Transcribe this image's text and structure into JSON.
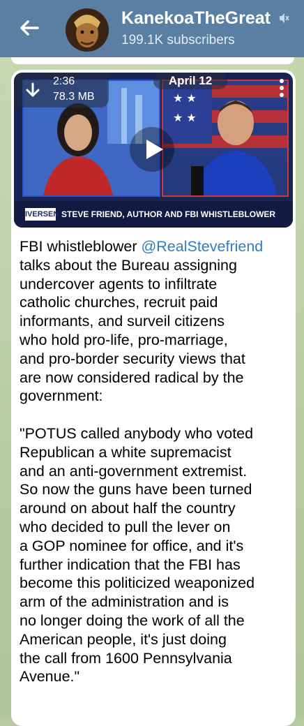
{
  "header": {
    "channel_name": "KanekoaTheGreat",
    "subscribers": "199.1K subscribers",
    "back_icon": "arrow-left-icon",
    "mute_icon": "speaker-muted-icon"
  },
  "video": {
    "duration": "2:36",
    "size": "78.3 MB",
    "date": "April 12",
    "show_name": "IVERSEN",
    "caption": "STEVE FRIEND, AUTHOR AND FBI WHISTLEBLOWER"
  },
  "message": {
    "intro": "FBI whistleblower ",
    "mention": "@RealStevefriend",
    "body": "\ntalks about the Bureau assigning\nundercover agents to infiltrate\ncatholic churches, recruit paid\ninformants, and surveil citizens\nwho hold pro-life, pro-marriage,\nand pro-border security views that\nare now considered radical by the\ngovernment:\n\n\"POTUS called anybody who voted\nRepublican a white supremacist\nand an anti-government extremist.\nSo now the guns have been turned\naround on about half the country\nwho decided to pull the lever on\na GOP nominee for office, and it's\nfurther indication that the FBI has\nbecome this politicized weaponized\narm of the administration and is\nno longer doing the work of all the\nAmerican people, it's just doing\nthe call from 1600 Pennsylvania\nAvenue.\""
  },
  "colors": {
    "header_bg": "#5a7fa3",
    "chat_bg": "#b7c9a0",
    "link": "#2e7cc2"
  }
}
